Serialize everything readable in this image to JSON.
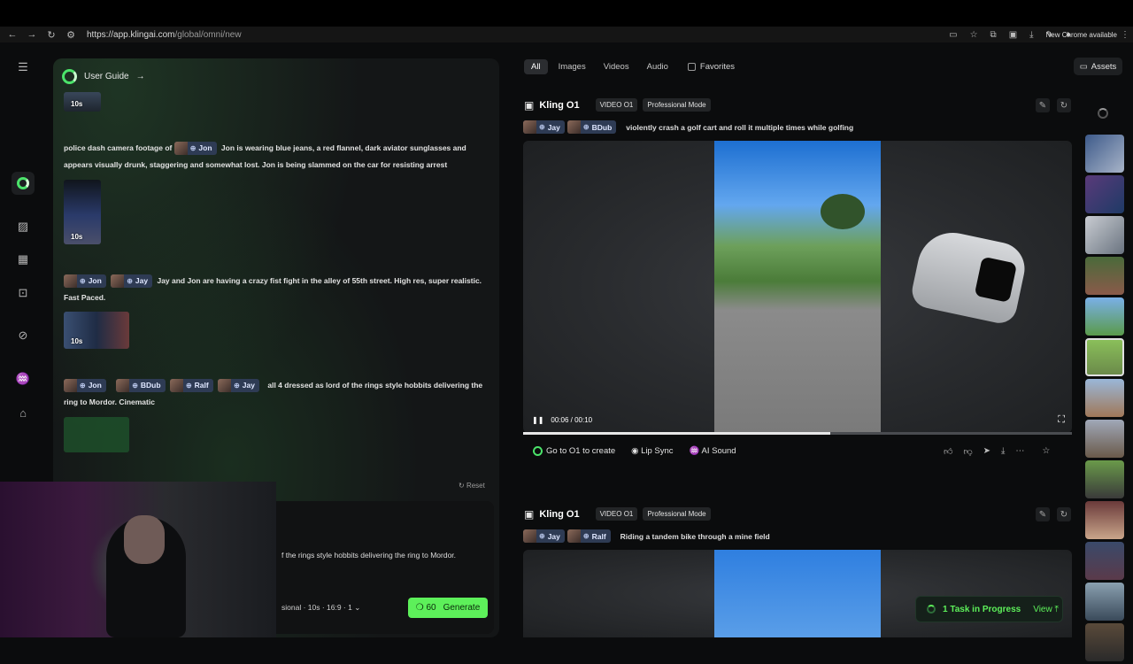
{
  "browser": {
    "url_host": "https://app.klingai.com",
    "url_path": "/global/omni/new",
    "chrome_label": "New Chrome available"
  },
  "chat": {
    "guide_label": "User Guide",
    "guide_arrow": "→",
    "items": [
      {
        "duration": "10s"
      },
      {
        "prompt_prefix": "police dash camera footage of",
        "chips": [
          "Jon"
        ],
        "prompt_text": "Jon is wearing blue jeans, a red flannel, dark aviator sunglasses and appears visually drunk, staggering and somewhat lost. Jon is being slammed on the car for resisting arrest",
        "duration": "10s"
      },
      {
        "chips": [
          "Jon",
          "Jay"
        ],
        "prompt_text": "Jay and Jon are having a crazy fist fight in the alley of 55th street. High res, super realistic. Fast Paced.",
        "duration": "10s"
      },
      {
        "chips": [
          "Jon",
          "BDub",
          "Ralf",
          "Jay"
        ],
        "prompt_text": "all 4 dressed as lord of the rings style hobbits delivering the ring to Mordor. Cinematic"
      }
    ],
    "reset_label": "Reset",
    "input_text": "f the rings style hobbits delivering the ring to Mordor.",
    "settings_label": "sional · 10s · 16:9 · 1",
    "generate_cost": "60",
    "generate_label": "Generate"
  },
  "filters": {
    "tabs": [
      "All",
      "Images",
      "Videos",
      "Audio"
    ],
    "favorites_label": "Favorites",
    "assets_label": "Assets"
  },
  "cards": [
    {
      "model": "Kling O1",
      "tags": [
        "VIDEO O1",
        "Professional Mode"
      ],
      "chips": [
        "Jay",
        "BDub"
      ],
      "prompt": "violently crash a golf cart and roll it multiple times while golfing",
      "time": "00:06 / 00:10",
      "progress": 0.56
    },
    {
      "model": "Kling O1",
      "tags": [
        "VIDEO O1",
        "Professional Mode"
      ],
      "chips": [
        "Jay",
        "Ralf"
      ],
      "prompt": "Riding a tandem bike through a mine field"
    }
  ],
  "actions": {
    "create_label": "Go to O1 to create",
    "lipsync_label": "Lip Sync",
    "aisound_label": "AI Sound"
  },
  "task": {
    "label": "1 Task in Progress",
    "view_label": "View"
  },
  "colors": {
    "accent_green": "#5df05a",
    "chip_blue": "#2e3b54"
  }
}
